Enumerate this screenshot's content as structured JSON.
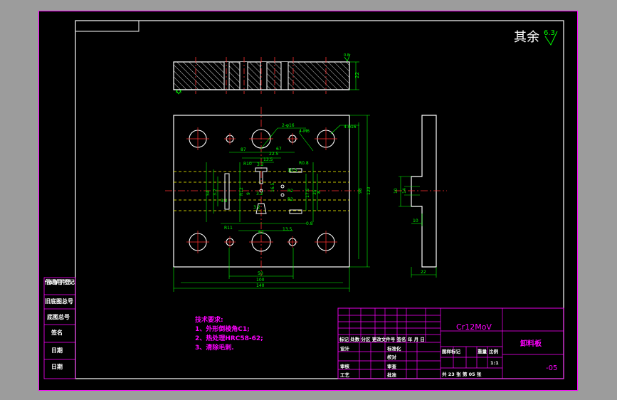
{
  "roughness": {
    "prefix": "其余",
    "value": "6.3"
  },
  "top_view": {
    "left_label": "6.3",
    "right_label": "0.8",
    "thickness": "22"
  },
  "plan_dims": {
    "hole_callout_1": "2-φ16",
    "hole_callout_2": "4-M6",
    "hole_callout_3": "4-φ16",
    "d_87": "87",
    "d_67": "67",
    "d_22_5": "22.5",
    "d_13_5_top": "13.5",
    "d_10_5": "10.5",
    "d_r10": "R10",
    "d_r0_8": "R0.8",
    "d_3_2_a": "3.2",
    "d_3_2_b": "3.2",
    "d_3_2_c": "3.2",
    "d_3_2_d": "3.2",
    "d_3_2_e": "3.2",
    "d_r11": "R11",
    "d_r12": "R12",
    "d_54": "54",
    "d_9": "9",
    "d_62": "62",
    "d_13_5_bot": "13.5",
    "d_0_8": "0.8",
    "d_r2": "R2",
    "d_r2_b": "R2",
    "d_16_5": "16.5",
    "d_17_5": "17.5",
    "d_35": "35",
    "d_8": "8",
    "d_50": "50",
    "d_100": "100",
    "d_140": "140",
    "d_98": "98",
    "d_120": "120"
  },
  "side_dims": {
    "d_10": "10",
    "d_14": "14",
    "d_10_b": "10",
    "d_22": "22"
  },
  "tech": {
    "title": "技术要求:",
    "item1": "1、外形倒棱角C1;",
    "item2": "2、热处理HRC58-62;",
    "item3": "3、清除毛刺."
  },
  "left_strip": [
    "借(通)用件登记",
    "旧底图总号",
    "底图总号",
    "签名",
    "日期",
    "日期"
  ],
  "title_block": {
    "material": "Cr12MoV",
    "part_name": "卸料板",
    "drawing_no": "-05",
    "scale": "1:1",
    "sheet_info": "共 23 张   第 05 张",
    "rev_headers": "标记 处数 分区 更改文件号 签名 年 月 日",
    "h_design": "设计",
    "h_standard": "标准化",
    "h_drawing": "图样标记",
    "h_weight": "重量",
    "h_scale": "比例",
    "h_proofread": "校对",
    "h_review": "审核",
    "h_approve": "批准",
    "h_process": "工艺",
    "h_check": "审查"
  }
}
